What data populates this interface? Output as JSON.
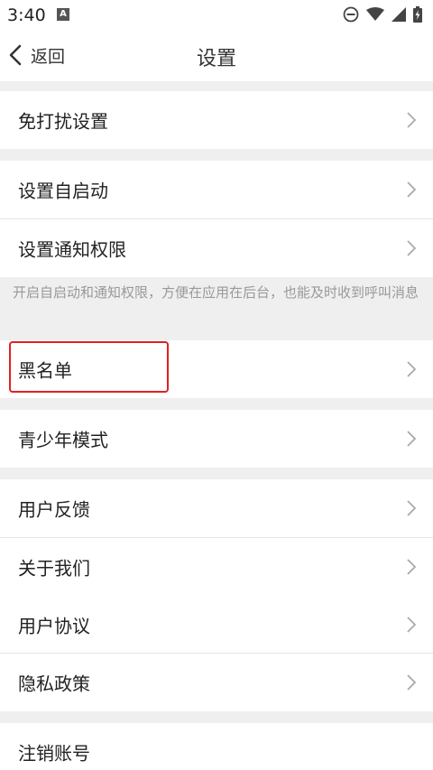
{
  "status_bar": {
    "time": "3:40",
    "notification_icon_letter": "A"
  },
  "nav": {
    "back_label": "返回",
    "title": "设置"
  },
  "rows": {
    "dnd": "免打扰设置",
    "autostart": "设置自启动",
    "notify_permission": "设置通知权限",
    "blacklist": "黑名单",
    "teen_mode": "青少年模式",
    "feedback": "用户反馈",
    "about": "关于我们",
    "user_agreement": "用户协议",
    "privacy": "隐私政策",
    "cancel_account": "注销账号"
  },
  "note": "开启自启动和通知权限，方便在应用在后台，也能及时收到呼叫消息",
  "colors": {
    "highlight": "#e02020",
    "background": "#efefef",
    "row_background": "#ffffff"
  }
}
